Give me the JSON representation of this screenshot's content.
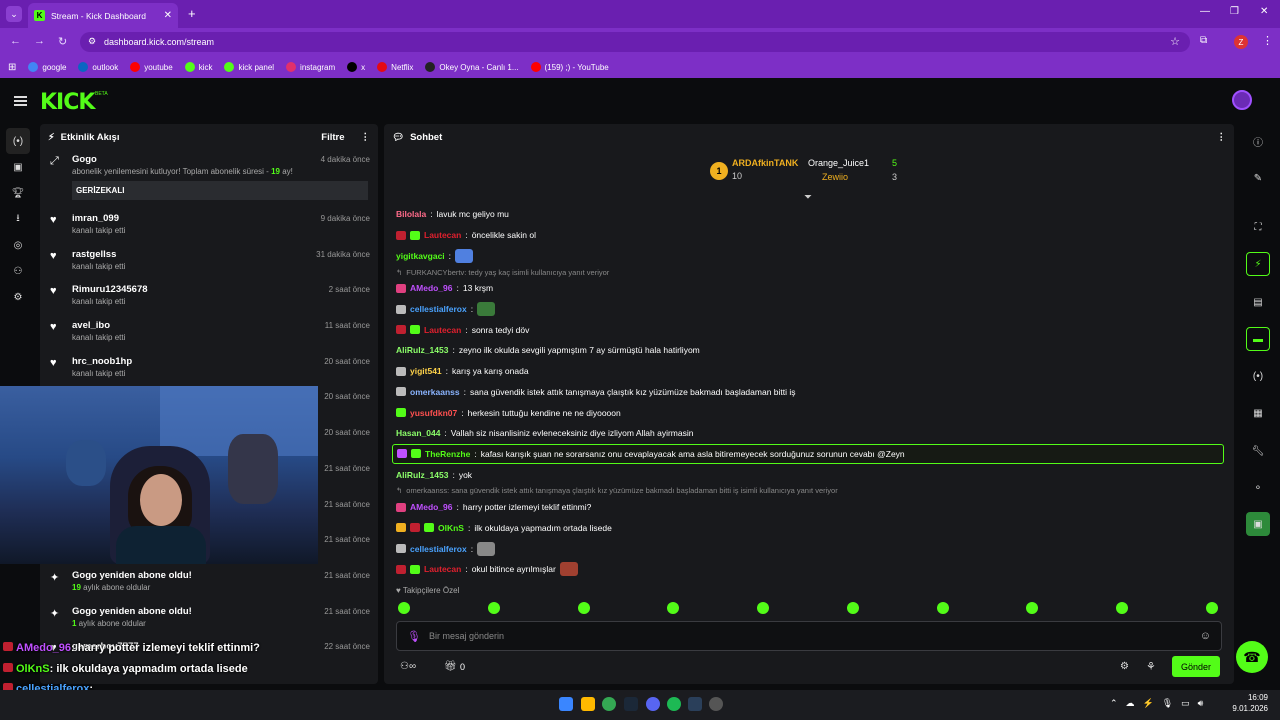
{
  "browser": {
    "tab_title": "Stream - Kick Dashboard",
    "url": "dashboard.kick.com/stream",
    "profile_initial": "Z",
    "bookmarks": [
      {
        "label": "google",
        "color": "#4285f4"
      },
      {
        "label": "outlook",
        "color": "#0a66c2"
      },
      {
        "label": "youtube",
        "color": "#ff0000"
      },
      {
        "label": "kick",
        "color": "#53fc18"
      },
      {
        "label": "kick panel",
        "color": "#53fc18"
      },
      {
        "label": "instagram",
        "color": "#e1306c"
      },
      {
        "label": "x",
        "color": "#000000"
      },
      {
        "label": "Netflix",
        "color": "#e50914"
      },
      {
        "label": "Okey Oyna - Canlı 1...",
        "color": "#222222"
      },
      {
        "label": "(159) ;) - YouTube",
        "color": "#ff0000"
      }
    ]
  },
  "header": {
    "logo": "KICK",
    "beta": "BETA"
  },
  "activity": {
    "title": "Etkinlik Akışı",
    "filter_label": "Filtre",
    "items": [
      {
        "icon": "sub-icon",
        "name": "Gogo",
        "sub": "abonelik yenilemesini kutluyor! Toplam abonelik süresi - ",
        "highlight": "19",
        "sub_end": " ay!",
        "time": "4 dakika önce",
        "message": "GERİZEKALI"
      },
      {
        "icon": "heart-icon",
        "name": "imran_099",
        "sub": "kanalı takip etti",
        "time": "9 dakika önce"
      },
      {
        "icon": "heart-icon",
        "name": "rastgellss",
        "sub": "kanalı takip etti",
        "time": "31 dakika önce"
      },
      {
        "icon": "heart-icon",
        "name": "Rimuru12345678",
        "sub": "kanalı takip etti",
        "time": "2 saat önce"
      },
      {
        "icon": "heart-icon",
        "name": "avel_ibo",
        "sub": "kanalı takip etti",
        "time": "11 saat önce"
      },
      {
        "icon": "heart-icon",
        "name": "hrc_noob1hp",
        "sub": "kanalı takip etti",
        "time": "20 saat önce"
      }
    ],
    "hidden_times": [
      "20 saat önce",
      "20 saat önce",
      "21 saat önce",
      "21 saat önce",
      "21 saat önce"
    ],
    "bottom_items": [
      {
        "icon": "sparkle-icon",
        "name": "Gogo yeniden abone oldu!",
        "highlight": "19",
        "sub": " aylık abone oldular",
        "time": "21 saat önce"
      },
      {
        "icon": "sparkle-icon",
        "name": "Gogo yeniden abone oldu!",
        "highlight": "1",
        "sub": " aylık abone oldular",
        "time": "21 saat önce"
      },
      {
        "icon": "heart-icon",
        "name": "gamerboy7777",
        "sub": "",
        "time": "22 saat önce"
      }
    ]
  },
  "chat": {
    "title": "Sohbet",
    "leaders": {
      "first_name": "ARDAfkinTANK",
      "first_count": "10",
      "second_name": "Orange_Juice1",
      "second_count": "5",
      "third_name": "Zewiio",
      "third_count": "3"
    },
    "messages": [
      {
        "user": "Bilolala",
        "color": "#ff6b8a",
        "text": "lavuk mc geliyo mu",
        "badges": [],
        "emote": ""
      },
      {
        "user": "Lautecan",
        "color": "#e0202e",
        "text": "öncelikle sakin ol",
        "badges": [
          "#c02030",
          "#53fc18"
        ],
        "emote": ""
      },
      {
        "user": "yigitkavgaci",
        "color": "#53fc18",
        "text": "",
        "badges": [],
        "emote": "#5080e0"
      },
      {
        "reply": true,
        "text": "FURKANCYbertv: tedy yaş kaç isimli kullanıcıya yanıt veriyor"
      },
      {
        "user": "AMedo_96",
        "color": "#c050ff",
        "text": "13 krşm",
        "badges": [
          "#e04080"
        ],
        "emote": ""
      },
      {
        "user": "cellestialferox",
        "color": "#4aa3ff",
        "text": "",
        "badges": [
          "#bbbbbb"
        ],
        "emote": "#3a7a3a"
      },
      {
        "user": "Lautecan",
        "color": "#e0202e",
        "text": "sonra tedyi döv",
        "badges": [
          "#c02030",
          "#53fc18"
        ],
        "emote": ""
      },
      {
        "user": "AliRulz_1453",
        "color": "#8cff6a",
        "text": "zeyno ilk okulda sevgili yapmıştım 7 ay sürmüştü hala hatirliyom",
        "badges": [],
        "emote": ""
      },
      {
        "user": "yigit541",
        "color": "#ffd34a",
        "text": "karış ya karış onada",
        "badges": [
          "#bbbbbb"
        ],
        "emote": ""
      },
      {
        "user": "omerkaanss",
        "color": "#8ab4ff",
        "text": "sana güvendik istek attık tanışmaya çlaıştık kız yüzümüze bakmadı başladaman bitti iş",
        "badges": [
          "#bbbbbb"
        ],
        "emote": ""
      },
      {
        "user": "yusufdkn07",
        "color": "#ff5050",
        "text": "herkesin tuttuğu kendine ne ne diyoooon",
        "badges": [
          "#53fc18"
        ],
        "emote": ""
      },
      {
        "user": "Hasan_044",
        "color": "#8cff6a",
        "text": "Vallah siz nisanlisiniz evleneceksiniz diye izliyom Allah ayirmasin",
        "badges": [],
        "emote": ""
      },
      {
        "user": "TheRenzhe",
        "color": "#53fc18",
        "text": "kafası karışık şuan ne sorarsanız onu cevaplayacak ama asla bitiremeyecek sorduğunuz sorunun cevabı @Zeyn",
        "badges": [
          "#c050ff",
          "#53fc18"
        ],
        "emote": "",
        "highlight": true
      },
      {
        "user": "AliRulz_1453",
        "color": "#8cff6a",
        "text": "yok",
        "badges": [],
        "emote": ""
      },
      {
        "reply": true,
        "text": "omerkaanss: sana güvendik istek attık tanışmaya çlaıştık kız yüzümüze bakmadı başladaman bitti iş isimli kullanıcıya yanıt veriyor"
      },
      {
        "user": "AMedo_96",
        "color": "#c050ff",
        "text": "harry potter izlemeyi teklif ettinmi?",
        "badges": [
          "#e04080"
        ],
        "emote": ""
      },
      {
        "user": "OlKnS",
        "color": "#53fc18",
        "text": "ilk okuldaya yapmadım ortada lisede",
        "badges": [
          "#f0b020",
          "#c02030",
          "#53fc18"
        ],
        "emote": ""
      },
      {
        "user": "cellestialferox",
        "color": "#4aa3ff",
        "text": "",
        "badges": [
          "#bbbbbb"
        ],
        "emote": "#888888"
      },
      {
        "user": "Lautecan",
        "color": "#e0202e",
        "text": "okul bitince ayrılmışlar",
        "badges": [
          "#c02030",
          "#53fc18"
        ],
        "emote": "#a04030"
      }
    ],
    "followers_only": "Takipçilere Özel",
    "input_placeholder": "Bir mesaj gönderin",
    "points": "0",
    "send_label": "Gönder"
  },
  "overlay": [
    {
      "user": "AMedo_96",
      "color": "#c050ff",
      "text": ": harry potter izlemeyi teklif ettinmi?"
    },
    {
      "user": "OlKnS",
      "color": "#53fc18",
      "text": ": ilk okuldaya yapmadım ortada lisede"
    },
    {
      "user": "cellestialferox",
      "color": "#4aa3ff",
      "text": ":"
    },
    {
      "user": "Lautecan",
      "color": "#e0202e",
      "text": ": okul bitince ayrılmışlar"
    }
  ],
  "taskbar": {
    "time": "16:09",
    "date": "9.01.2026"
  }
}
